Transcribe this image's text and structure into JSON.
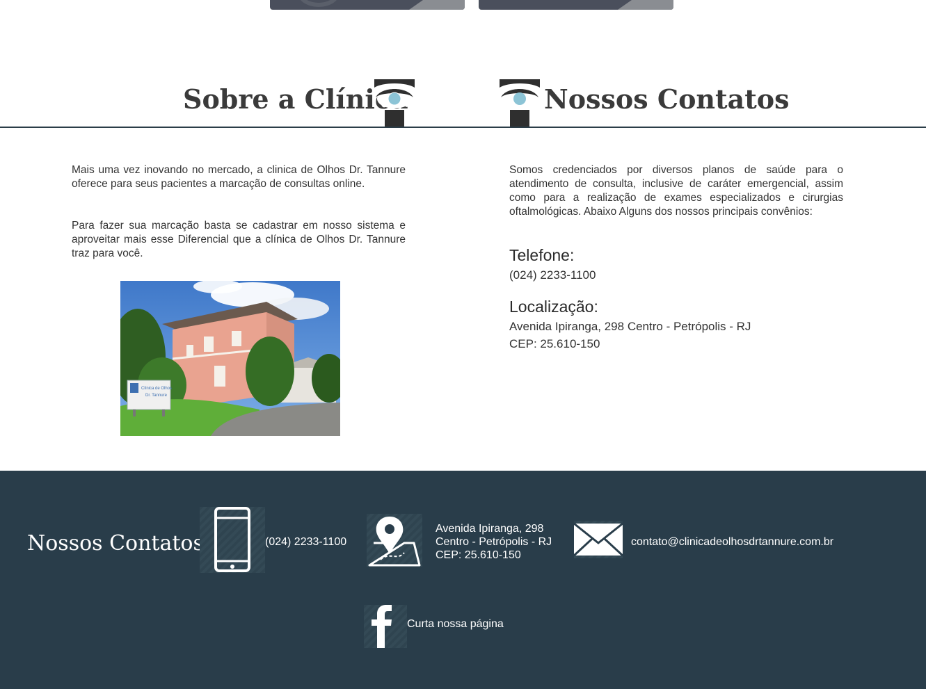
{
  "about": {
    "title": "Sobre a Clínica",
    "paragraph1": "Mais uma vez inovando no mercado, a clinica de Olhos Dr. Tannure oferece para seus pacientes a marcação de consultas online.",
    "paragraph2": "Para fazer sua marcação basta se cadastrar em nosso sistema e aproveitar mais esse Diferencial que a clínica de Olhos Dr. Tannure traz para você.",
    "photo_sign_line1": "Clínica de Olhos",
    "photo_sign_line2": "Dr. Tannure"
  },
  "contacts": {
    "title": "Nossos Contatos",
    "paragraph": "Somos credenciados por diversos planos de saúde para o atendimento de consulta, inclusive de caráter emergencial, assim como para a realização de exames especializados e cirurgias oftalmológicas. Abaixo Alguns dos nossos principais convênios:",
    "phone_heading": "Telefone:",
    "phone": "(024) 2233-1100",
    "location_heading": "Localização:",
    "address": "Avenida Ipiranga, 298 Centro - Petrópolis - RJ",
    "cep": "CEP: 25.610-150"
  },
  "footer": {
    "title": "Nossos Contatos",
    "phone": "(024) 2233-1100",
    "address_line1": "Avenida Ipiranga, 298",
    "address_line2": "Centro - Petrópolis - RJ",
    "address_line3": "CEP: 25.610-150",
    "email": "contato@clinicadeolhosdrtannure.com.br",
    "facebook_label": "Curta nossa página"
  },
  "colors": {
    "footer_bg": "#293d4a",
    "eye_iris": "#8cc4d6",
    "logo_dark": "#2f2f2f"
  },
  "icons": [
    "eye-logo-icon",
    "phone-icon",
    "map-pin-icon",
    "envelope-icon",
    "facebook-icon"
  ]
}
